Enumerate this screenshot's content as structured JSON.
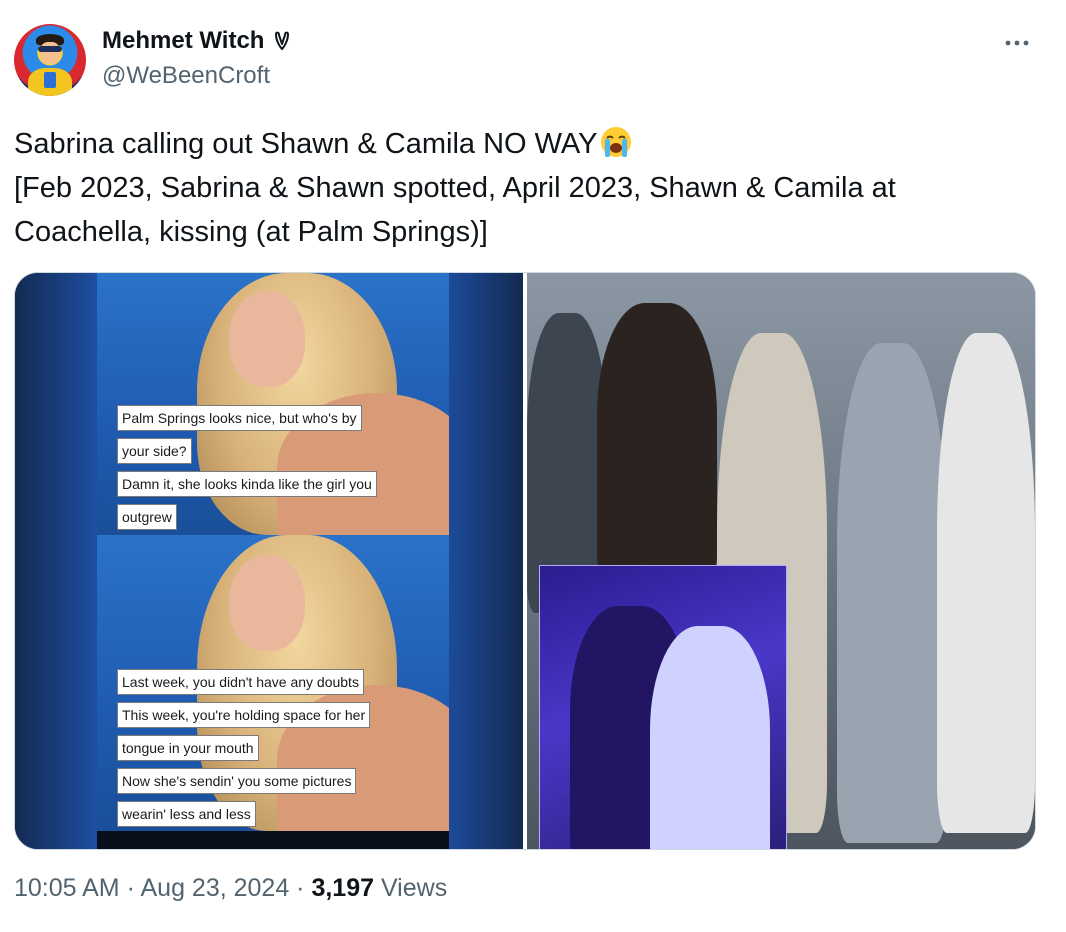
{
  "author": {
    "display_name": "Mehmet Witch",
    "handle": "@WeBeenCroft",
    "avatar_icon": "superhero-avatar-icon",
    "badge_icon": "ribbon-badge-icon"
  },
  "tweet": {
    "text_line1": "Sabrina calling out Shawn & Camila NO WAY",
    "emoji": "loudly-crying-face-emoji",
    "text_line2": "[Feb 2023, Sabrina & Shawn spotted, April 2023, Shawn & Camila at",
    "text_line3": "Coachella, kissing (at Palm Springs)]"
  },
  "media": {
    "left_top_captions": [
      "Palm Springs looks nice, but who's by",
      "your side?",
      "Damn it, she looks kinda like the girl you",
      "outgrew"
    ],
    "left_bottom_captions": [
      "Last week, you didn't have any doubts",
      "This week, you're holding space for her",
      "tongue in your mouth",
      "Now she's sendin' you some pictures",
      "wearin' less and less"
    ]
  },
  "meta": {
    "time": "10:05 AM",
    "separator": " · ",
    "date": "Aug 23, 2024",
    "views_count": "3,197",
    "views_label": " Views"
  },
  "colors": {
    "text_primary": "#0f1419",
    "text_secondary": "#536471",
    "border": "#cfd9de"
  }
}
